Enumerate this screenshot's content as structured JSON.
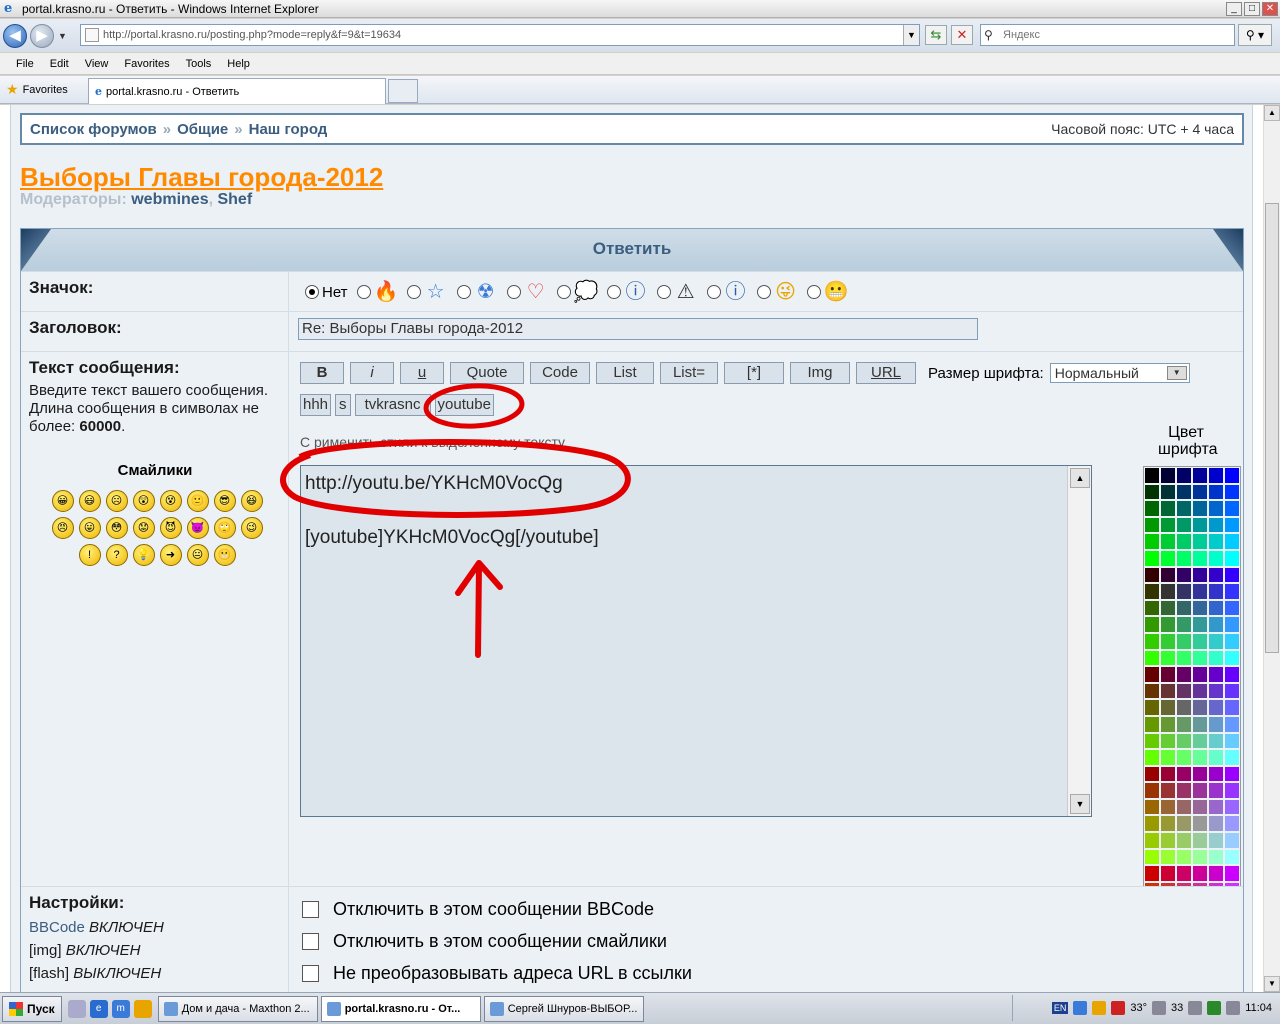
{
  "window": {
    "title": "portal.krasno.ru - Ответить - Windows Internet Explorer",
    "controls": [
      "_",
      "□",
      "✕"
    ]
  },
  "address": {
    "url": "http://portal.krasno.ru/posting.php?mode=reply&f=9&t=19634",
    "search_placeholder": "Яндекс"
  },
  "menu": [
    "File",
    "Edit",
    "View",
    "Favorites",
    "Tools",
    "Help"
  ],
  "favbar": {
    "favorites_label": "Favorites",
    "tab_title": "portal.krasno.ru - Ответить"
  },
  "breadcrumb": {
    "items": [
      "Список форумов",
      "Общие",
      "Наш город"
    ],
    "separator": "»",
    "timezone": "Часовой пояс: UTC + 4 часа"
  },
  "forum": {
    "title": "Выборы Главы города-2012",
    "moderators_label": "Модераторы:",
    "moderators": [
      "webmines",
      "Shef"
    ]
  },
  "form": {
    "header": "Ответить",
    "icon_label": "Значок:",
    "icon_none": "Нет",
    "icons": [
      "flame-icon",
      "star-icon",
      "radiation-icon",
      "heart-icon",
      "speech-bubble-icon",
      "question-icon",
      "warning-icon",
      "info-icon",
      "wink-icon",
      "grin-icon"
    ],
    "subject_label": "Заголовок:",
    "subject_value": "Re: Выборы Главы города-2012",
    "message_label": "Текст сообщения:",
    "message_desc": "Введите текст вашего сообщения. Длина сообщения в символах не более: ",
    "message_limit": "60000",
    "message_desc_end": ".",
    "toolbar": [
      "B",
      "i",
      "u",
      "Quote",
      "Code",
      "List",
      "List=",
      "[*]",
      "Img",
      "URL"
    ],
    "toolbar2": [
      "hhh",
      "s",
      "tvkrasnc",
      "youtube"
    ],
    "font_size_label": "Размер шрифта:",
    "font_size_value": "Нормальный",
    "hint": "С                    рименить стили к выделенному тексту.",
    "message_text": "http://youtu.be/YKHcM0VocQg\n\n[youtube]YKHcM0VocQg[/youtube]",
    "font_color_label": "Цвет шрифта",
    "smilies_title": "Смайлики",
    "settings_label": "Настройки:",
    "settings_status": [
      {
        "name": "BBCode",
        "state": "ВКЛЮЧЕН"
      },
      {
        "name": "[img]",
        "state": "ВКЛЮЧЕН"
      },
      {
        "name": "[flash]",
        "state": "ВЫКЛЮЧЕН"
      }
    ],
    "options": [
      "Отключить в этом сообщении BBCode",
      "Отключить в этом сообщении смайлики",
      "Не преобразовывать адреса URL в ссылки"
    ]
  },
  "palette_colors": [
    "#000000",
    "#000033",
    "#000066",
    "#000099",
    "#0000cc",
    "#0000ff",
    "#003300",
    "#003333",
    "#003366",
    "#003399",
    "#0033cc",
    "#0033ff",
    "#006600",
    "#006633",
    "#006666",
    "#006699",
    "#0066cc",
    "#0066ff",
    "#009900",
    "#009933",
    "#009966",
    "#009999",
    "#0099cc",
    "#0099ff",
    "#00cc00",
    "#00cc33",
    "#00cc66",
    "#00cc99",
    "#00cccc",
    "#00ccff",
    "#00ff00",
    "#00ff33",
    "#00ff66",
    "#00ff99",
    "#00ffcc",
    "#00ffff",
    "#330000",
    "#330033",
    "#330066",
    "#330099",
    "#3300cc",
    "#3300ff",
    "#333300",
    "#333333",
    "#333366",
    "#333399",
    "#3333cc",
    "#3333ff",
    "#336600",
    "#336633",
    "#336666",
    "#336699",
    "#3366cc",
    "#3366ff",
    "#339900",
    "#339933",
    "#339966",
    "#339999",
    "#3399cc",
    "#3399ff",
    "#33cc00",
    "#33cc33",
    "#33cc66",
    "#33cc99",
    "#33cccc",
    "#33ccff",
    "#33ff00",
    "#33ff33",
    "#33ff66",
    "#33ff99",
    "#33ffcc",
    "#33ffff",
    "#660000",
    "#660033",
    "#660066",
    "#660099",
    "#6600cc",
    "#6600ff",
    "#663300",
    "#663333",
    "#663366",
    "#663399",
    "#6633cc",
    "#6633ff",
    "#666600",
    "#666633",
    "#666666",
    "#666699",
    "#6666cc",
    "#6666ff",
    "#669900",
    "#669933",
    "#669966",
    "#669999",
    "#6699cc",
    "#6699ff",
    "#66cc00",
    "#66cc33",
    "#66cc66",
    "#66cc99",
    "#66cccc",
    "#66ccff",
    "#66ff00",
    "#66ff33",
    "#66ff66",
    "#66ff99",
    "#66ffcc",
    "#66ffff",
    "#990000",
    "#990033",
    "#990066",
    "#990099",
    "#9900cc",
    "#9900ff",
    "#993300",
    "#993333",
    "#993366",
    "#993399",
    "#9933cc",
    "#9933ff",
    "#996600",
    "#996633",
    "#996666",
    "#996699",
    "#9966cc",
    "#9966ff",
    "#999900",
    "#999933",
    "#999966",
    "#999999",
    "#9999cc",
    "#9999ff",
    "#99cc00",
    "#99cc33",
    "#99cc66",
    "#99cc99",
    "#99cccc",
    "#99ccff",
    "#99ff00",
    "#99ff33",
    "#99ff66",
    "#99ff99",
    "#99ffcc",
    "#99ffff",
    "#cc0000",
    "#cc0033",
    "#cc0066",
    "#cc0099",
    "#cc00cc",
    "#cc00ff",
    "#cc3300",
    "#cc3333",
    "#cc3366",
    "#cc3399",
    "#cc33cc",
    "#cc33ff",
    "#cc6600",
    "#cc6633",
    "#cc6666",
    "#cc6699",
    "#cc66cc",
    "#cc66ff",
    "#cc9900",
    "#cc9933",
    "#cc9966",
    "#cc9999",
    "#cc99cc",
    "#cc99ff",
    "#cccc00",
    "#cccc33",
    "#cccc66",
    "#cccc99",
    "#cccccc",
    "#ccccff",
    "#ccff00",
    "#ccff33",
    "#ccff66",
    "#ccff99",
    "#ccffcc",
    "#ccffff",
    "#ff0000",
    "#ff0033",
    "#ff0066",
    "#ff0099",
    "#ff00cc",
    "#ff00ff",
    "#ff3300",
    "#ff3333",
    "#ff3366",
    "#ff3399",
    "#ff33cc",
    "#ff33ff",
    "#ff6600",
    "#ff6633",
    "#ff6666",
    "#ff6699",
    "#ff66cc",
    "#ff66ff",
    "#ff9900",
    "#ff9933",
    "#ff9966",
    "#ff9999",
    "#ff99cc",
    "#ff99ff",
    "#ffcc00",
    "#ffcc33",
    "#ffcc66",
    "#ffcc99",
    "#ffcccc",
    "#ffccff",
    "#ffff00",
    "#ffff33",
    "#ffff66",
    "#ffff99",
    "#ffffcc",
    "#ffffff"
  ],
  "smilies": [
    "😀",
    "😃",
    "☹",
    "😲",
    "😵",
    "🙂",
    "😎",
    "😆",
    "😠",
    "😛",
    "😳",
    "😟",
    "😈",
    "👿",
    "🙄",
    "😉",
    "!",
    "?",
    "💡",
    "➜",
    "😐",
    "😬"
  ],
  "taskbar": {
    "start": "Пуск",
    "tasks": [
      "Дом и дача - Maxthon 2...",
      "portal.krasno.ru - От...",
      "Сергей Шнуров-ВЫБОР..."
    ],
    "active_task": 1,
    "tray_lang": "EN",
    "tray_temp1": "33°",
    "tray_temp2": "33",
    "clock": "11:04"
  },
  "colors": {
    "accent_orange": "#ff8a00",
    "link_blue": "#3a5d80",
    "annotation_red": "#e00000"
  }
}
